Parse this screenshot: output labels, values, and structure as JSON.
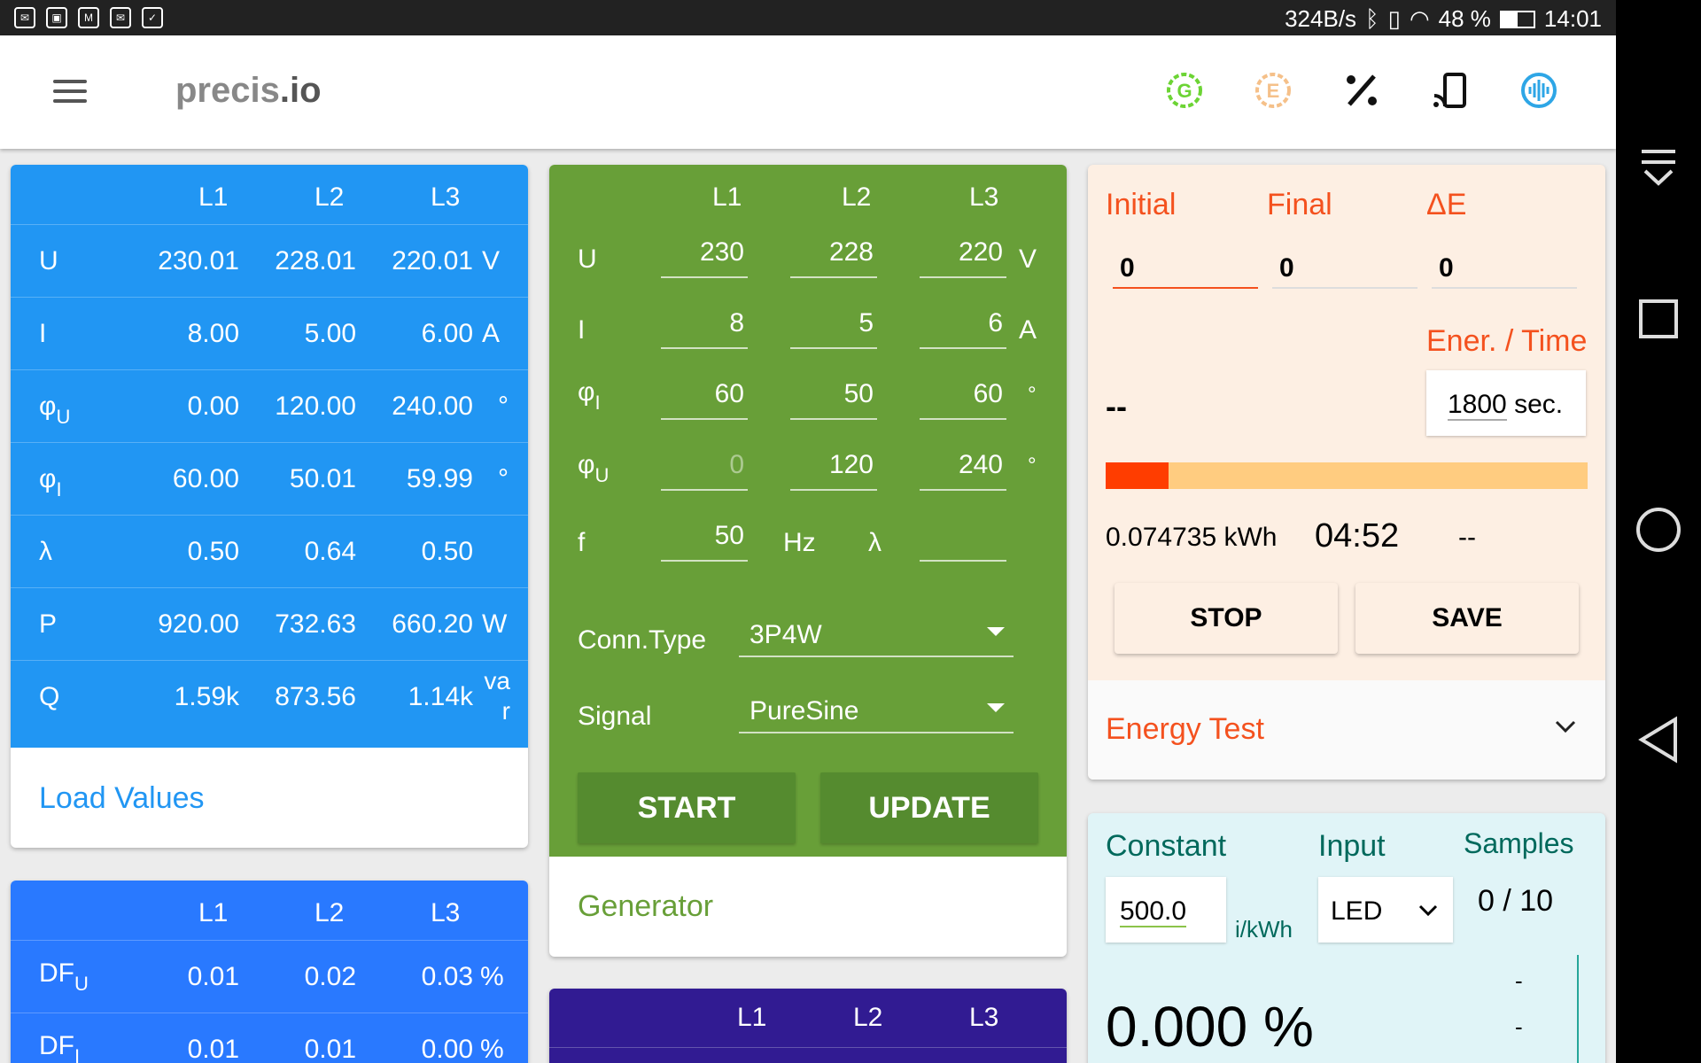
{
  "status_bar": {
    "net_speed": "324B/s",
    "battery": "48 %",
    "time": "14:01"
  },
  "app": {
    "logo_main": "precis",
    "logo_suffix": ".io"
  },
  "top_icons": [
    "generator-icon",
    "energy-icon",
    "percent-icon",
    "cast-icon",
    "signal-icon"
  ],
  "load_values": {
    "title": "Load Values",
    "headers": [
      "L1",
      "L2",
      "L3"
    ],
    "rows": [
      {
        "label": "U",
        "sub": "",
        "values": [
          "230.01",
          "228.01",
          "220.01"
        ],
        "unit": "V"
      },
      {
        "label": "I",
        "sub": "",
        "values": [
          "8.00",
          "5.00",
          "6.00"
        ],
        "unit": "A"
      },
      {
        "label": "φ",
        "sub": "U",
        "values": [
          "0.00",
          "120.00",
          "240.00"
        ],
        "unit": "°"
      },
      {
        "label": "φ",
        "sub": "I",
        "values": [
          "60.00",
          "50.01",
          "59.99"
        ],
        "unit": "°"
      },
      {
        "label": "λ",
        "sub": "",
        "values": [
          "0.50",
          "0.64",
          "0.50"
        ],
        "unit": ""
      },
      {
        "label": "P",
        "sub": "",
        "values": [
          "920.00",
          "732.63",
          "660.20"
        ],
        "unit": "W"
      },
      {
        "label": "Q",
        "sub": "",
        "values": [
          "1.59k",
          "873.56",
          "1.14k"
        ],
        "unit": "va\nr"
      }
    ]
  },
  "df_values": {
    "headers": [
      "L1",
      "L2",
      "L3"
    ],
    "rows": [
      {
        "label": "DF",
        "sub": "U",
        "values": [
          "0.01",
          "0.02",
          "0.03"
        ],
        "unit": "%"
      },
      {
        "label": "DF",
        "sub": "I",
        "values": [
          "0.01",
          "0.01",
          "0.00"
        ],
        "unit": "%"
      }
    ]
  },
  "generator": {
    "title": "Generator",
    "headers": [
      "L1",
      "L2",
      "L3"
    ],
    "rows": [
      {
        "label": "U",
        "sub": "",
        "values": [
          "230",
          "228",
          "220"
        ],
        "unit": "V"
      },
      {
        "label": "I",
        "sub": "",
        "values": [
          "8",
          "5",
          "6"
        ],
        "unit": "A"
      },
      {
        "label": "φ",
        "sub": "I",
        "values": [
          "60",
          "50",
          "60"
        ],
        "unit": "°"
      },
      {
        "label": "φ",
        "sub": "U",
        "values": [
          "0",
          "120",
          "240"
        ],
        "unit": "°"
      }
    ],
    "freq_label": "f",
    "freq_value": "50",
    "freq_unit": "Hz",
    "lambda_label": "λ",
    "lambda_value": "",
    "conn_type_label": "Conn.Type",
    "conn_type_value": "3P4W",
    "signal_label": "Signal",
    "signal_value": "PureSine",
    "start_label": "START",
    "update_label": "UPDATE"
  },
  "harmonics_headers": [
    "L1",
    "L2",
    "L3"
  ],
  "energy_test": {
    "title": "Energy Test",
    "initial_label": "Initial",
    "final_label": "Final",
    "delta_label": "ΔE",
    "initial_value": "0",
    "final_value": "0",
    "delta_value": "0",
    "ener_time_label": "Ener. / Time",
    "result": "--",
    "time_value": "1800",
    "time_unit": "sec.",
    "progress": 0.13,
    "energy_reading": "0.074735 kWh",
    "elapsed": "04:52",
    "extra": "--",
    "stop_label": "STOP",
    "save_label": "SAVE"
  },
  "constant_test": {
    "constant_label": "Constant",
    "input_label": "Input",
    "samples_label": "Samples",
    "constant_value": "500.0",
    "constant_unit": "i/kWh",
    "input_value": "LED",
    "samples_value": "0 / 10",
    "error_value": "0.000 %",
    "side_values": [
      "-",
      "-"
    ]
  },
  "colors": {
    "load_card": "#2196F3",
    "generator_card": "#689F38",
    "energy_card": "#FDEFE3",
    "accent_orange": "#F4511E",
    "progress_bg": "#FFCC80",
    "constant_card": "#E0F4F7"
  }
}
